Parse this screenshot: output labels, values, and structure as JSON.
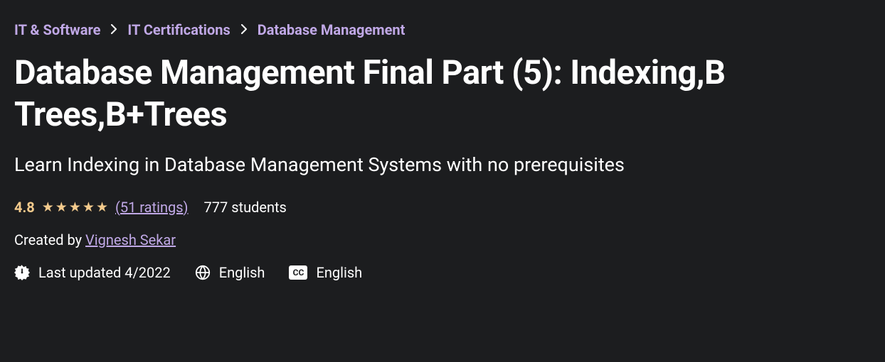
{
  "breadcrumb": {
    "items": [
      "IT & Software",
      "IT Certifications",
      "Database Management"
    ]
  },
  "title": "Database Management Final Part (5): Indexing,B Trees,B+Trees",
  "subtitle": "Learn Indexing in Database Management Systems with no prerequisites",
  "rating": {
    "value": "4.8",
    "ratingsText": "(51 ratings)",
    "studentsText": "777 students"
  },
  "creator": {
    "prefix": "Created by ",
    "name": "Vignesh Sekar"
  },
  "info": {
    "lastUpdated": "Last updated 4/2022",
    "language": "English",
    "captions": "English"
  }
}
